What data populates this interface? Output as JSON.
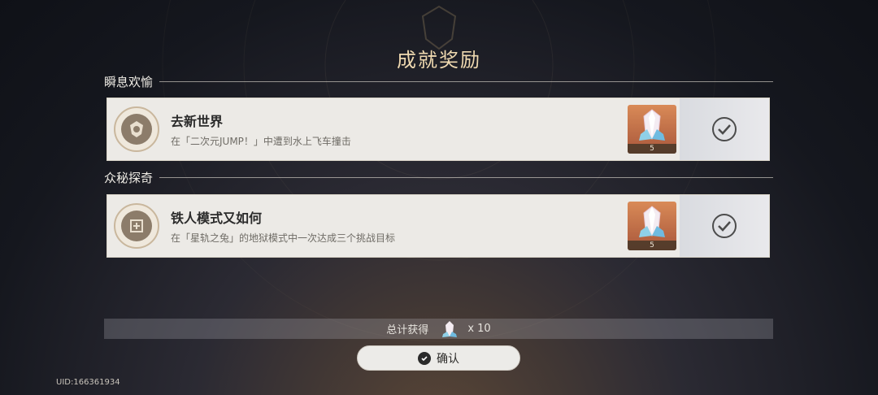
{
  "title": "成就奖励",
  "sections": [
    {
      "label": "瞬息欢愉",
      "achievement": {
        "title": "去新世界",
        "description": "在「二次元JUMP！」中遭到水上飞车撞击",
        "reward_count": "5"
      }
    },
    {
      "label": "众秘探奇",
      "achievement": {
        "title": "铁人模式又如何",
        "description": "在「星轨之兔」的地狱模式中一次达成三个挑战目标",
        "reward_count": "5"
      }
    }
  ],
  "total": {
    "label": "总计获得",
    "amount": "x 10"
  },
  "confirm_label": "确认",
  "uid": "UID:166361934",
  "colors": {
    "title": "#efd9b0",
    "card": "#eceae6",
    "reward_bg": "#c9754e"
  },
  "icons": [
    "crystal-gem-icon",
    "check-icon",
    "achievement-badge-icon"
  ]
}
